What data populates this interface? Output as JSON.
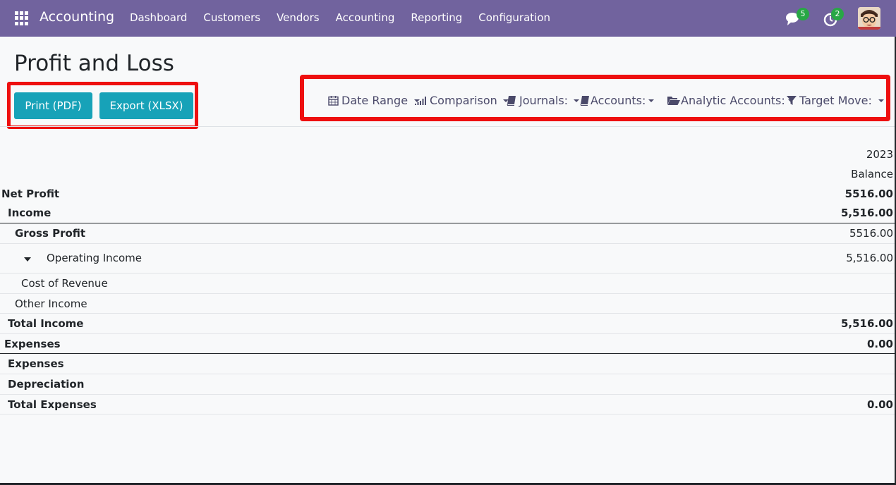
{
  "navbar": {
    "app_name": "Accounting",
    "menu": [
      "Dashboard",
      "Customers",
      "Vendors",
      "Accounting",
      "Reporting",
      "Configuration"
    ],
    "chat_count": "5",
    "activity_count": "2",
    "accent": "#71639e"
  },
  "page": {
    "title": "Profit and Loss",
    "buttons": {
      "print": "Print (PDF)",
      "export": "Export (XLSX)"
    },
    "filters": {
      "date_range": "Date Range",
      "comparison": "Comparison",
      "journals": "Journals:",
      "accounts": "Accounts:",
      "analytic": "Analytic Accounts:",
      "target_move": "Target Move:"
    }
  },
  "report": {
    "header_year": "2023",
    "header_col": "Balance",
    "rows": [
      {
        "label": "Net Profit",
        "value": "5516.00"
      },
      {
        "label": "Income",
        "value": "5,516.00"
      },
      {
        "label": "Gross Profit",
        "value": "5516.00"
      },
      {
        "label": "Operating Income",
        "value": "5,516.00"
      },
      {
        "label": "Cost of Revenue",
        "value": ""
      },
      {
        "label": "Other Income",
        "value": ""
      },
      {
        "label": "Total Income",
        "value": "5,516.00"
      },
      {
        "label": "Expenses",
        "value": "0.00"
      },
      {
        "label": "Expenses",
        "value": ""
      },
      {
        "label": "Depreciation",
        "value": ""
      },
      {
        "label": "Total Expenses",
        "value": "0.00"
      }
    ]
  },
  "colors": {
    "button": "#17a2b8",
    "highlight": "#ee0f0f",
    "badge": "#28a745"
  }
}
